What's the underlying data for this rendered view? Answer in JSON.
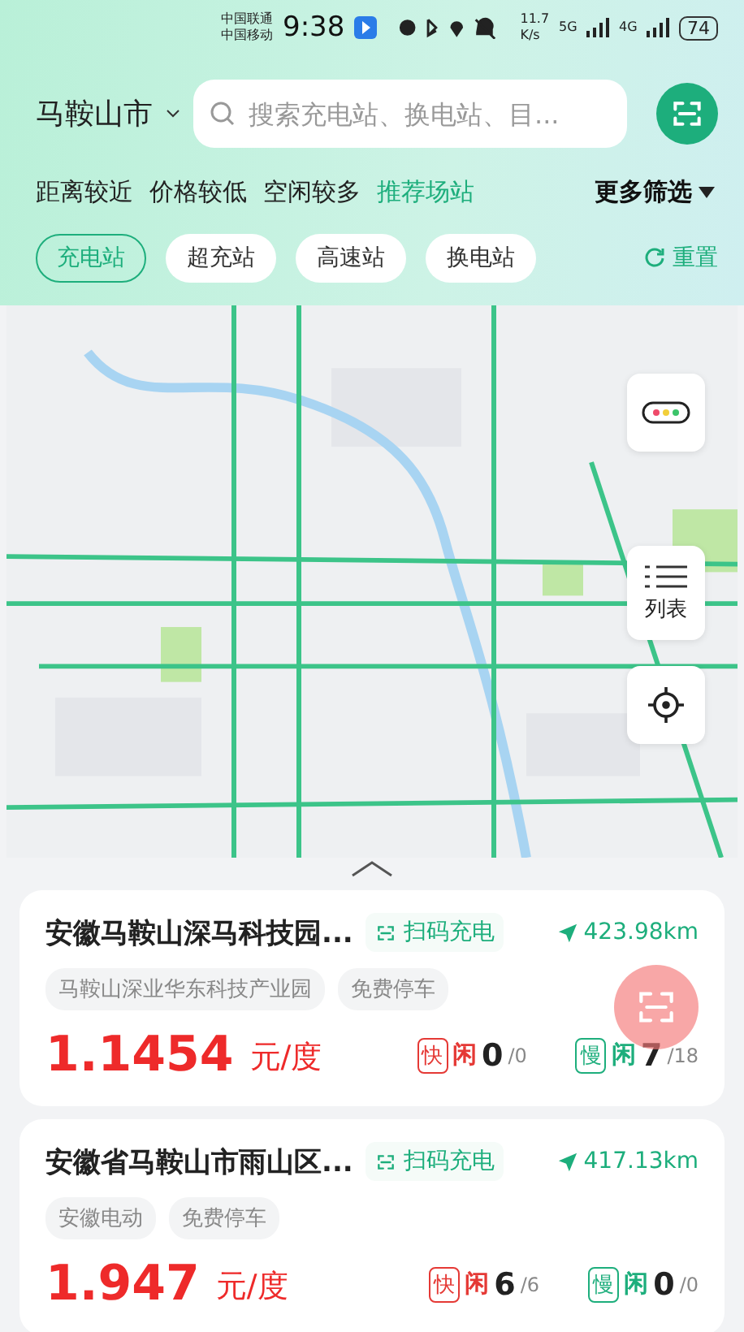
{
  "status_bar": {
    "carriers": [
      "中国联通",
      "中国移动"
    ],
    "time": "9:38",
    "speed": "11.7",
    "speed_unit": "K/s",
    "net_primary": "5G",
    "net_secondary": "4G",
    "battery": "74"
  },
  "header": {
    "city": "马鞍山市",
    "search": {
      "placeholder": "搜索充电站、换电站、目..."
    }
  },
  "sort_options": [
    {
      "label": "距离较近",
      "selected": false
    },
    {
      "label": "价格较低",
      "selected": false
    },
    {
      "label": "空闲较多",
      "selected": false
    },
    {
      "label": "推荐场站",
      "selected": true
    }
  ],
  "more_filters": "更多筛选",
  "station_types": [
    {
      "label": "充电站",
      "selected": true
    },
    {
      "label": "超充站",
      "selected": false
    },
    {
      "label": "高速站",
      "selected": false
    },
    {
      "label": "换电站",
      "selected": false
    }
  ],
  "reset": "重置",
  "map": {
    "kind": "picture",
    "list_button": "列表"
  },
  "stations": [
    {
      "name": "安徽马鞍山深马科技园...",
      "scan": "扫码充电",
      "distance": "423.98km",
      "tags": [
        "马鞍山深业华东科技产业园",
        "免费停车"
      ],
      "price": "1.1454",
      "unit": "元/度",
      "fast": {
        "badge": "快",
        "idle": "闲",
        "free": "0",
        "total": "/0"
      },
      "slow": {
        "badge": "慢",
        "idle": "闲",
        "free": "7",
        "total": "/18"
      }
    },
    {
      "name": "安徽省马鞍山市雨山区...",
      "scan": "扫码充电",
      "distance": "417.13km",
      "tags": [
        "安徽电动",
        "免费停车"
      ],
      "price": "1.947",
      "unit": "元/度",
      "fast": {
        "badge": "快",
        "idle": "闲",
        "free": "6",
        "total": "/6"
      },
      "slow": {
        "badge": "慢",
        "idle": "闲",
        "free": "0",
        "total": "/0"
      }
    }
  ]
}
